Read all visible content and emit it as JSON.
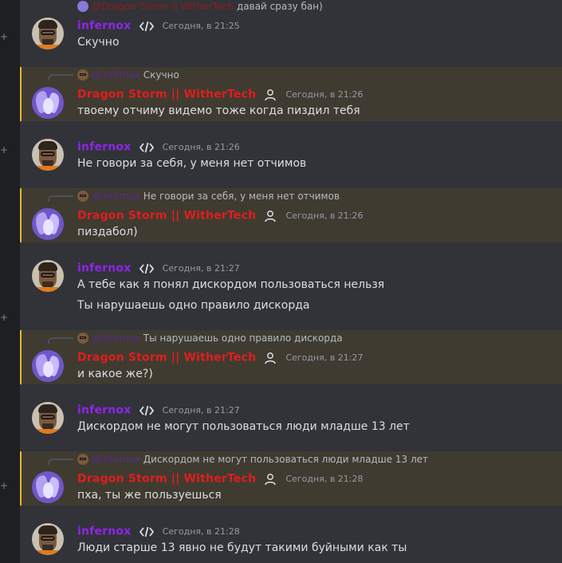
{
  "top_reply": {
    "author": "@Dragon Storm || WitherTech",
    "text": "давай сразу бан)"
  },
  "messages": [
    {
      "author": "infernox",
      "time": "Сегодня, в 21:25",
      "lines": [
        "Скучно"
      ]
    },
    {
      "reply_author": "@infernox",
      "reply_text": "Скучно",
      "author": "Dragon Storm || WitherTech",
      "time": "Сегодня, в 21:26",
      "lines": [
        "твоему отчиму видемо тоже когда пиздил тебя"
      ]
    },
    {
      "author": "infernox",
      "time": "Сегодня, в 21:26",
      "lines": [
        "Не говори за себя, у меня нет отчимов"
      ]
    },
    {
      "reply_author": "@infernox",
      "reply_text": "Не говори за себя, у меня нет отчимов",
      "author": "Dragon Storm || WitherTech",
      "time": "Сегодня, в 21:26",
      "lines": [
        "пиздабол)"
      ]
    },
    {
      "author": "infernox",
      "time": "Сегодня, в 21:27",
      "lines": [
        "А тебе как я понял дискордом пользоваться нельзя",
        "Ты нарушаешь одно правило дискорда"
      ]
    },
    {
      "reply_author": "@infernox",
      "reply_text": "Ты нарушаешь одно правило дискорда",
      "author": "Dragon Storm || WitherTech",
      "time": "Сегодня, в 21:27",
      "lines": [
        "и какое же?)"
      ]
    },
    {
      "author": "infernox",
      "time": "Сегодня, в 21:27",
      "lines": [
        "Дискордом не могут пользоваться люди младше 13 лет"
      ]
    },
    {
      "reply_author": "@infernox",
      "reply_text": "Дискордом не могут пользоваться люди младше 13 лет",
      "author": "Dragon Storm || WitherTech",
      "time": "Сегодня, в 21:28",
      "lines": [
        "пха, ты же пользуешься"
      ]
    },
    {
      "author": "infernox",
      "time": "Сегодня, в 21:28",
      "lines": [
        "Люди старше 13 явно не будут такими буйными как ты"
      ]
    }
  ],
  "icons": {
    "dev_tag": "code-brackets-icon",
    "role": "person-icon",
    "gutter": "plus-icon"
  },
  "colors": {
    "infernox_name": "#8e26e6",
    "dragon_name": "#e21d1d",
    "mention_highlight_bg": "#3f3b31",
    "mention_bar": "#f0b232",
    "chat_bg": "#313338",
    "text": "#dbdee1",
    "timestamp": "#949ba4"
  }
}
